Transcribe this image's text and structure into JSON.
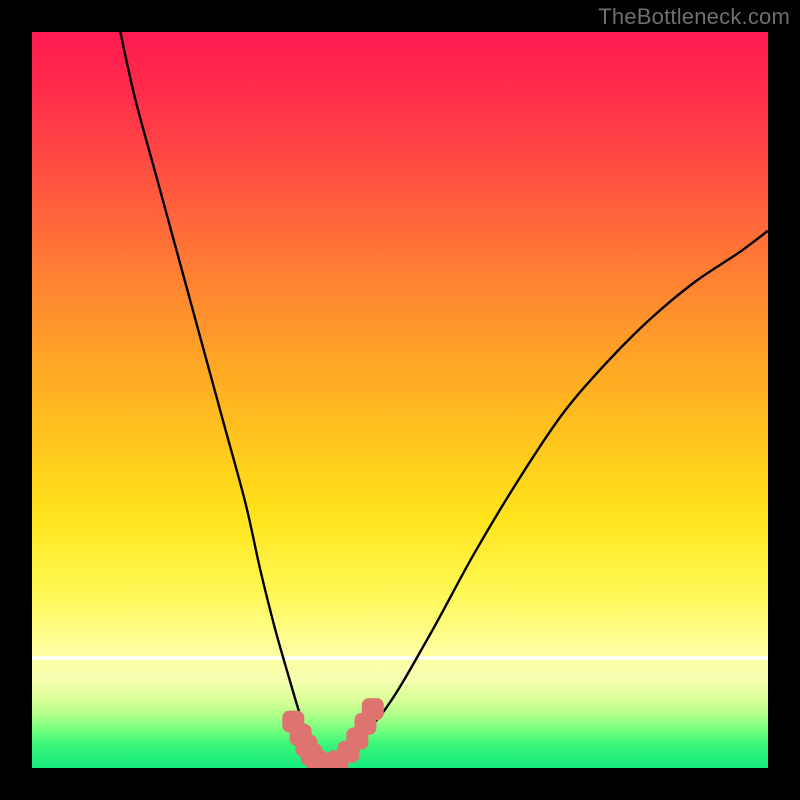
{
  "watermark": "TheBottleneck.com",
  "chart_data": {
    "type": "line",
    "title": "",
    "xlabel": "",
    "ylabel": "",
    "xlim": [
      0,
      100
    ],
    "ylim": [
      0,
      100
    ],
    "grid": false,
    "legend": false,
    "series": [
      {
        "name": "bottleneck-curve",
        "x": [
          12,
          14,
          17,
          20,
          23,
          26,
          29,
          31,
          33,
          35,
          36.5,
          38,
          39,
          40,
          42,
          48,
          54,
          60,
          66,
          72,
          78,
          84,
          90,
          96,
          100
        ],
        "y": [
          100,
          91,
          80,
          69,
          58,
          47,
          36,
          27,
          19,
          12,
          7,
          3,
          1,
          0,
          1.5,
          8,
          18,
          29,
          39,
          48,
          55,
          61,
          66,
          70,
          73
        ]
      },
      {
        "name": "marker-cluster",
        "x": [
          35.5,
          36.5,
          37.3,
          38.0,
          38.8,
          40.0,
          41.5,
          43.0,
          44.2,
          45.3,
          46.3
        ],
        "y": [
          6.3,
          4.5,
          3.0,
          1.8,
          0.9,
          0.2,
          0.9,
          2.2,
          4.0,
          6.0,
          8.0
        ]
      }
    ],
    "annotations": {
      "white_band_y": 15
    }
  }
}
